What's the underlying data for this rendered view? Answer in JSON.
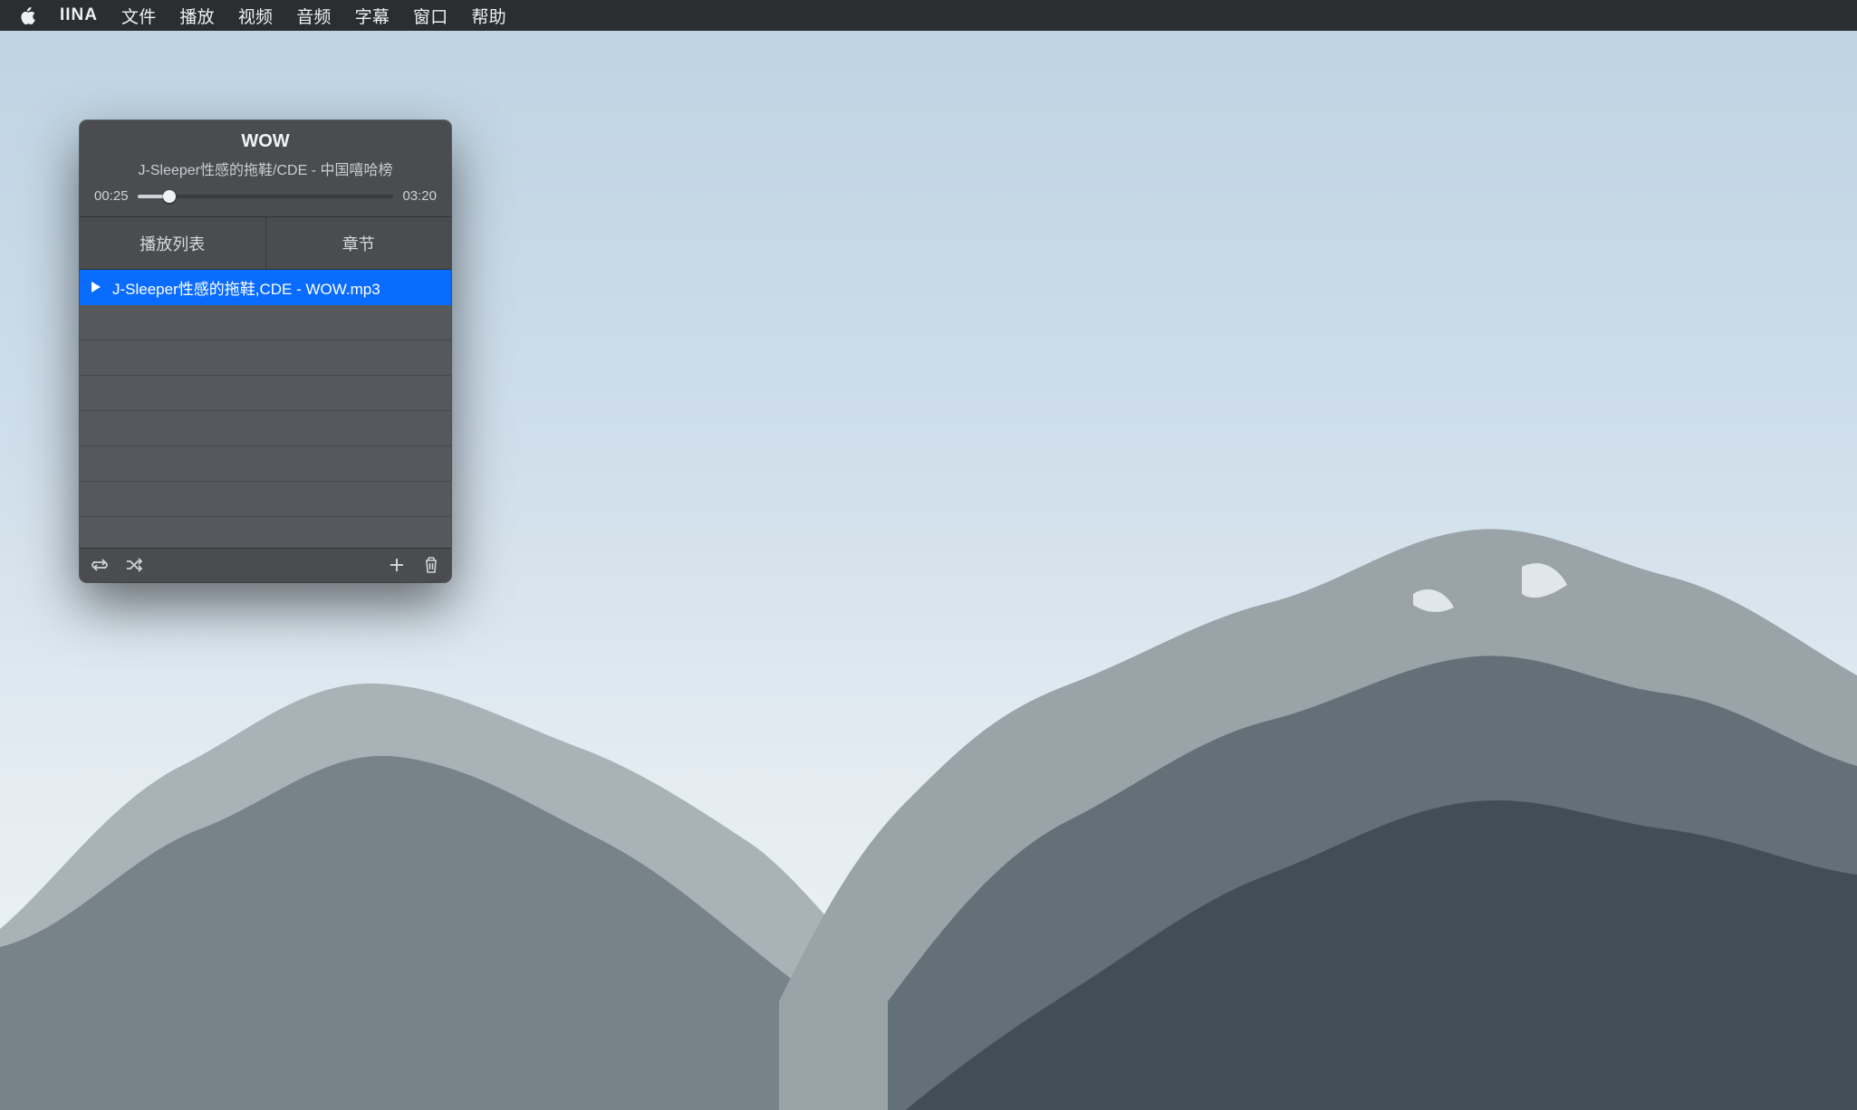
{
  "menubar": {
    "app": "IINA",
    "items": [
      "文件",
      "播放",
      "视频",
      "音频",
      "字幕",
      "窗口",
      "帮助"
    ]
  },
  "player": {
    "title": "WOW",
    "subtitle": "J-Sleeper性感的拖鞋/CDE - 中国嘻哈榜",
    "time_current": "00:25",
    "time_total": "03:20",
    "progress_percent": 12.5
  },
  "tabs": {
    "playlist": "播放列表",
    "chapters": "章节",
    "active": "playlist"
  },
  "playlist": {
    "items": [
      {
        "label": "J-Sleeper性感的拖鞋,CDE - WOW.mp3",
        "playing": true
      }
    ],
    "empty_rows": 7
  },
  "icons": {
    "apple": "apple-icon",
    "play": "play-icon",
    "loop": "loop-icon",
    "shuffle": "shuffle-icon",
    "add": "plus-icon",
    "trash": "trash-icon"
  },
  "colors": {
    "selection": "#0a6cff",
    "window_bg": "#4a4c50",
    "menubar_bg": "#2b2e30"
  }
}
